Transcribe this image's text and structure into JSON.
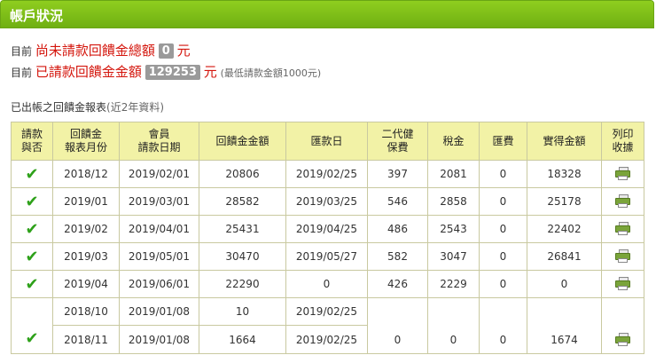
{
  "header": {
    "title": "帳戶狀況"
  },
  "status": {
    "unrequested_prefix": "目前",
    "unrequested_label": "尚未請款回饋金總額",
    "unrequested_amount": "0",
    "unrequested_unit": "元",
    "requested_prefix": "目前",
    "requested_label": "已請款回饋金金額",
    "requested_amount": "129253",
    "requested_unit": "元",
    "requested_note": "(最低請款金額1000元)"
  },
  "report": {
    "caption": "已出帳之回饋金報表",
    "caption_sub": "(近2年資料)",
    "headers": {
      "requested": [
        "請款",
        "與否"
      ],
      "month": [
        "回饋金",
        "報表月份"
      ],
      "request_date": [
        "會員",
        "請款日期"
      ],
      "amount": "回饋金金額",
      "remit_date": "匯款日",
      "nhi": [
        "二代健",
        "保費"
      ],
      "tax": "稅金",
      "fee": "匯費",
      "net": "實得金額",
      "print": [
        "列印",
        "收據"
      ]
    },
    "check_glyph": "✔",
    "rows": [
      {
        "month": "2018/12",
        "request_date": "2019/02/01",
        "amount": "20806",
        "remit_date": "2019/02/25",
        "nhi": "397",
        "tax": "2081",
        "fee": "0",
        "net": "18328"
      },
      {
        "month": "2019/01",
        "request_date": "2019/03/01",
        "amount": "28582",
        "remit_date": "2019/03/25",
        "nhi": "546",
        "tax": "2858",
        "fee": "0",
        "net": "25178"
      },
      {
        "month": "2019/02",
        "request_date": "2019/04/01",
        "amount": "25431",
        "remit_date": "2019/04/25",
        "nhi": "486",
        "tax": "2543",
        "fee": "0",
        "net": "22402"
      },
      {
        "month": "2019/03",
        "request_date": "2019/05/01",
        "amount": "30470",
        "remit_date": "2019/05/27",
        "nhi": "582",
        "tax": "3047",
        "fee": "0",
        "net": "26841"
      },
      {
        "month": "2019/04",
        "request_date": "2019/06/01",
        "amount": "22290",
        "remit_date": "0",
        "nhi": "426",
        "tax": "2229",
        "fee": "0",
        "net": "0"
      }
    ],
    "group": {
      "rows": [
        {
          "month": "2018/10",
          "request_date": "2019/01/08",
          "amount": "10",
          "remit_date": "2019/02/25"
        },
        {
          "month": "2018/11",
          "request_date": "2019/01/08",
          "amount": "1664",
          "remit_date": "2019/02/25"
        }
      ],
      "nhi": "0",
      "tax": "0",
      "fee": "0",
      "net": "1674"
    }
  }
}
